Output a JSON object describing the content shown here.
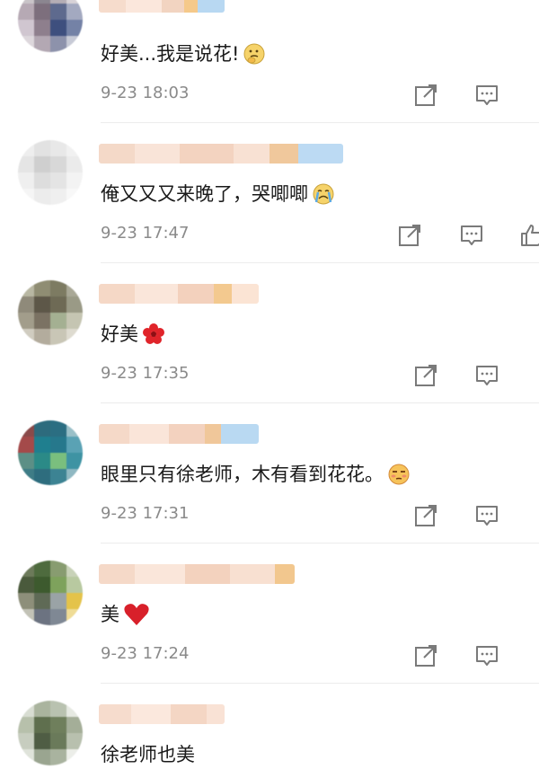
{
  "comments": [
    {
      "text": "好美...我是说花!",
      "emoji": "thinking-face-emoji",
      "time": "9-23 18:03"
    },
    {
      "text": "俺又又又来晚了，哭唧唧",
      "emoji": "crying-face-emoji",
      "time": "9-23 17:47"
    },
    {
      "text": "好美",
      "emoji": "red-flower-emoji",
      "time": "9-23 17:35"
    },
    {
      "text": "眼里只有徐老师，木有看到花花。",
      "emoji": "unamused-face-emoji",
      "time": "9-23 17:31"
    },
    {
      "text": "美",
      "emoji": "red-heart-emoji",
      "time": "9-23 17:24"
    },
    {
      "text": "徐老师也美"
    }
  ],
  "icons": {
    "share": "share-icon",
    "reply": "reply-icon",
    "like": "thumbs-up-icon"
  },
  "colors": {
    "text": "#1a1a1a",
    "meta": "#8a8a8a",
    "icon": "#7a7a7a",
    "divider": "#ececec"
  }
}
